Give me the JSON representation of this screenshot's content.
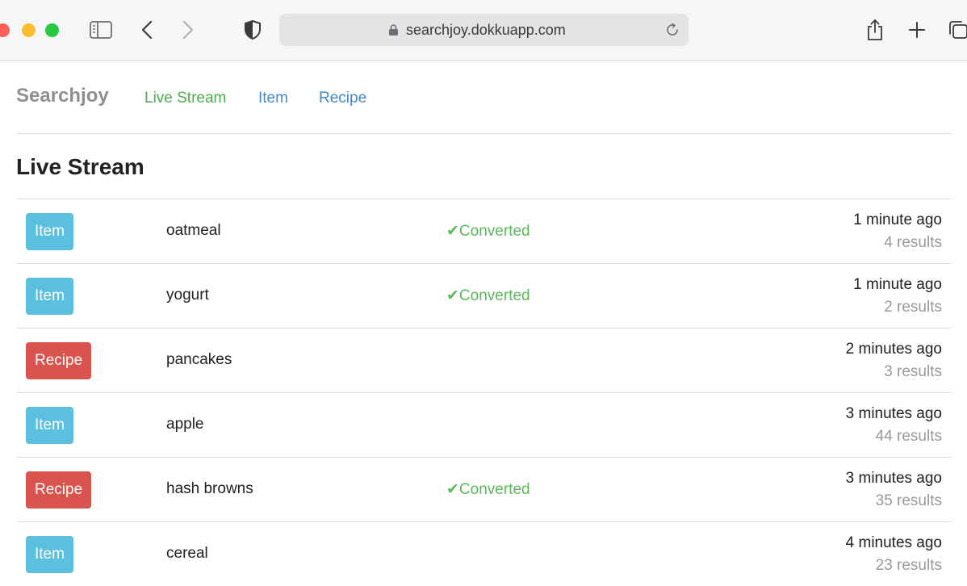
{
  "browser": {
    "url": "searchjoy.dokkuapp.com",
    "icons": [
      "sidebar-icon",
      "back-icon",
      "forward-icon",
      "privacy-shield-icon",
      "lock-icon",
      "reload-icon",
      "share-icon",
      "new-tab-icon",
      "tabs-overview-icon"
    ]
  },
  "nav": {
    "brand": "Searchjoy",
    "links": [
      {
        "label": "Live Stream",
        "active": true
      },
      {
        "label": "Item",
        "active": false
      },
      {
        "label": "Recipe",
        "active": false
      }
    ]
  },
  "page": {
    "title": "Live Stream"
  },
  "colors": {
    "item_badge": "#5bc0de",
    "recipe_badge": "#d9534f",
    "converted": "#5cb85c",
    "active_link": "#4cae4c",
    "link": "#428bca"
  },
  "searches": [
    {
      "type": "Item",
      "query": "oatmeal",
      "converted": "✔Converted",
      "time": "1 minute ago",
      "results": "4 results"
    },
    {
      "type": "Item",
      "query": "yogurt",
      "converted": "✔Converted",
      "time": "1 minute ago",
      "results": "2 results"
    },
    {
      "type": "Recipe",
      "query": "pancakes",
      "converted": "",
      "time": "2 minutes ago",
      "results": "3 results"
    },
    {
      "type": "Item",
      "query": "apple",
      "converted": "",
      "time": "3 minutes ago",
      "results": "44 results"
    },
    {
      "type": "Recipe",
      "query": "hash browns",
      "converted": "✔Converted",
      "time": "3 minutes ago",
      "results": "35 results"
    },
    {
      "type": "Item",
      "query": "cereal",
      "converted": "",
      "time": "4 minutes ago",
      "results": "23 results"
    }
  ]
}
